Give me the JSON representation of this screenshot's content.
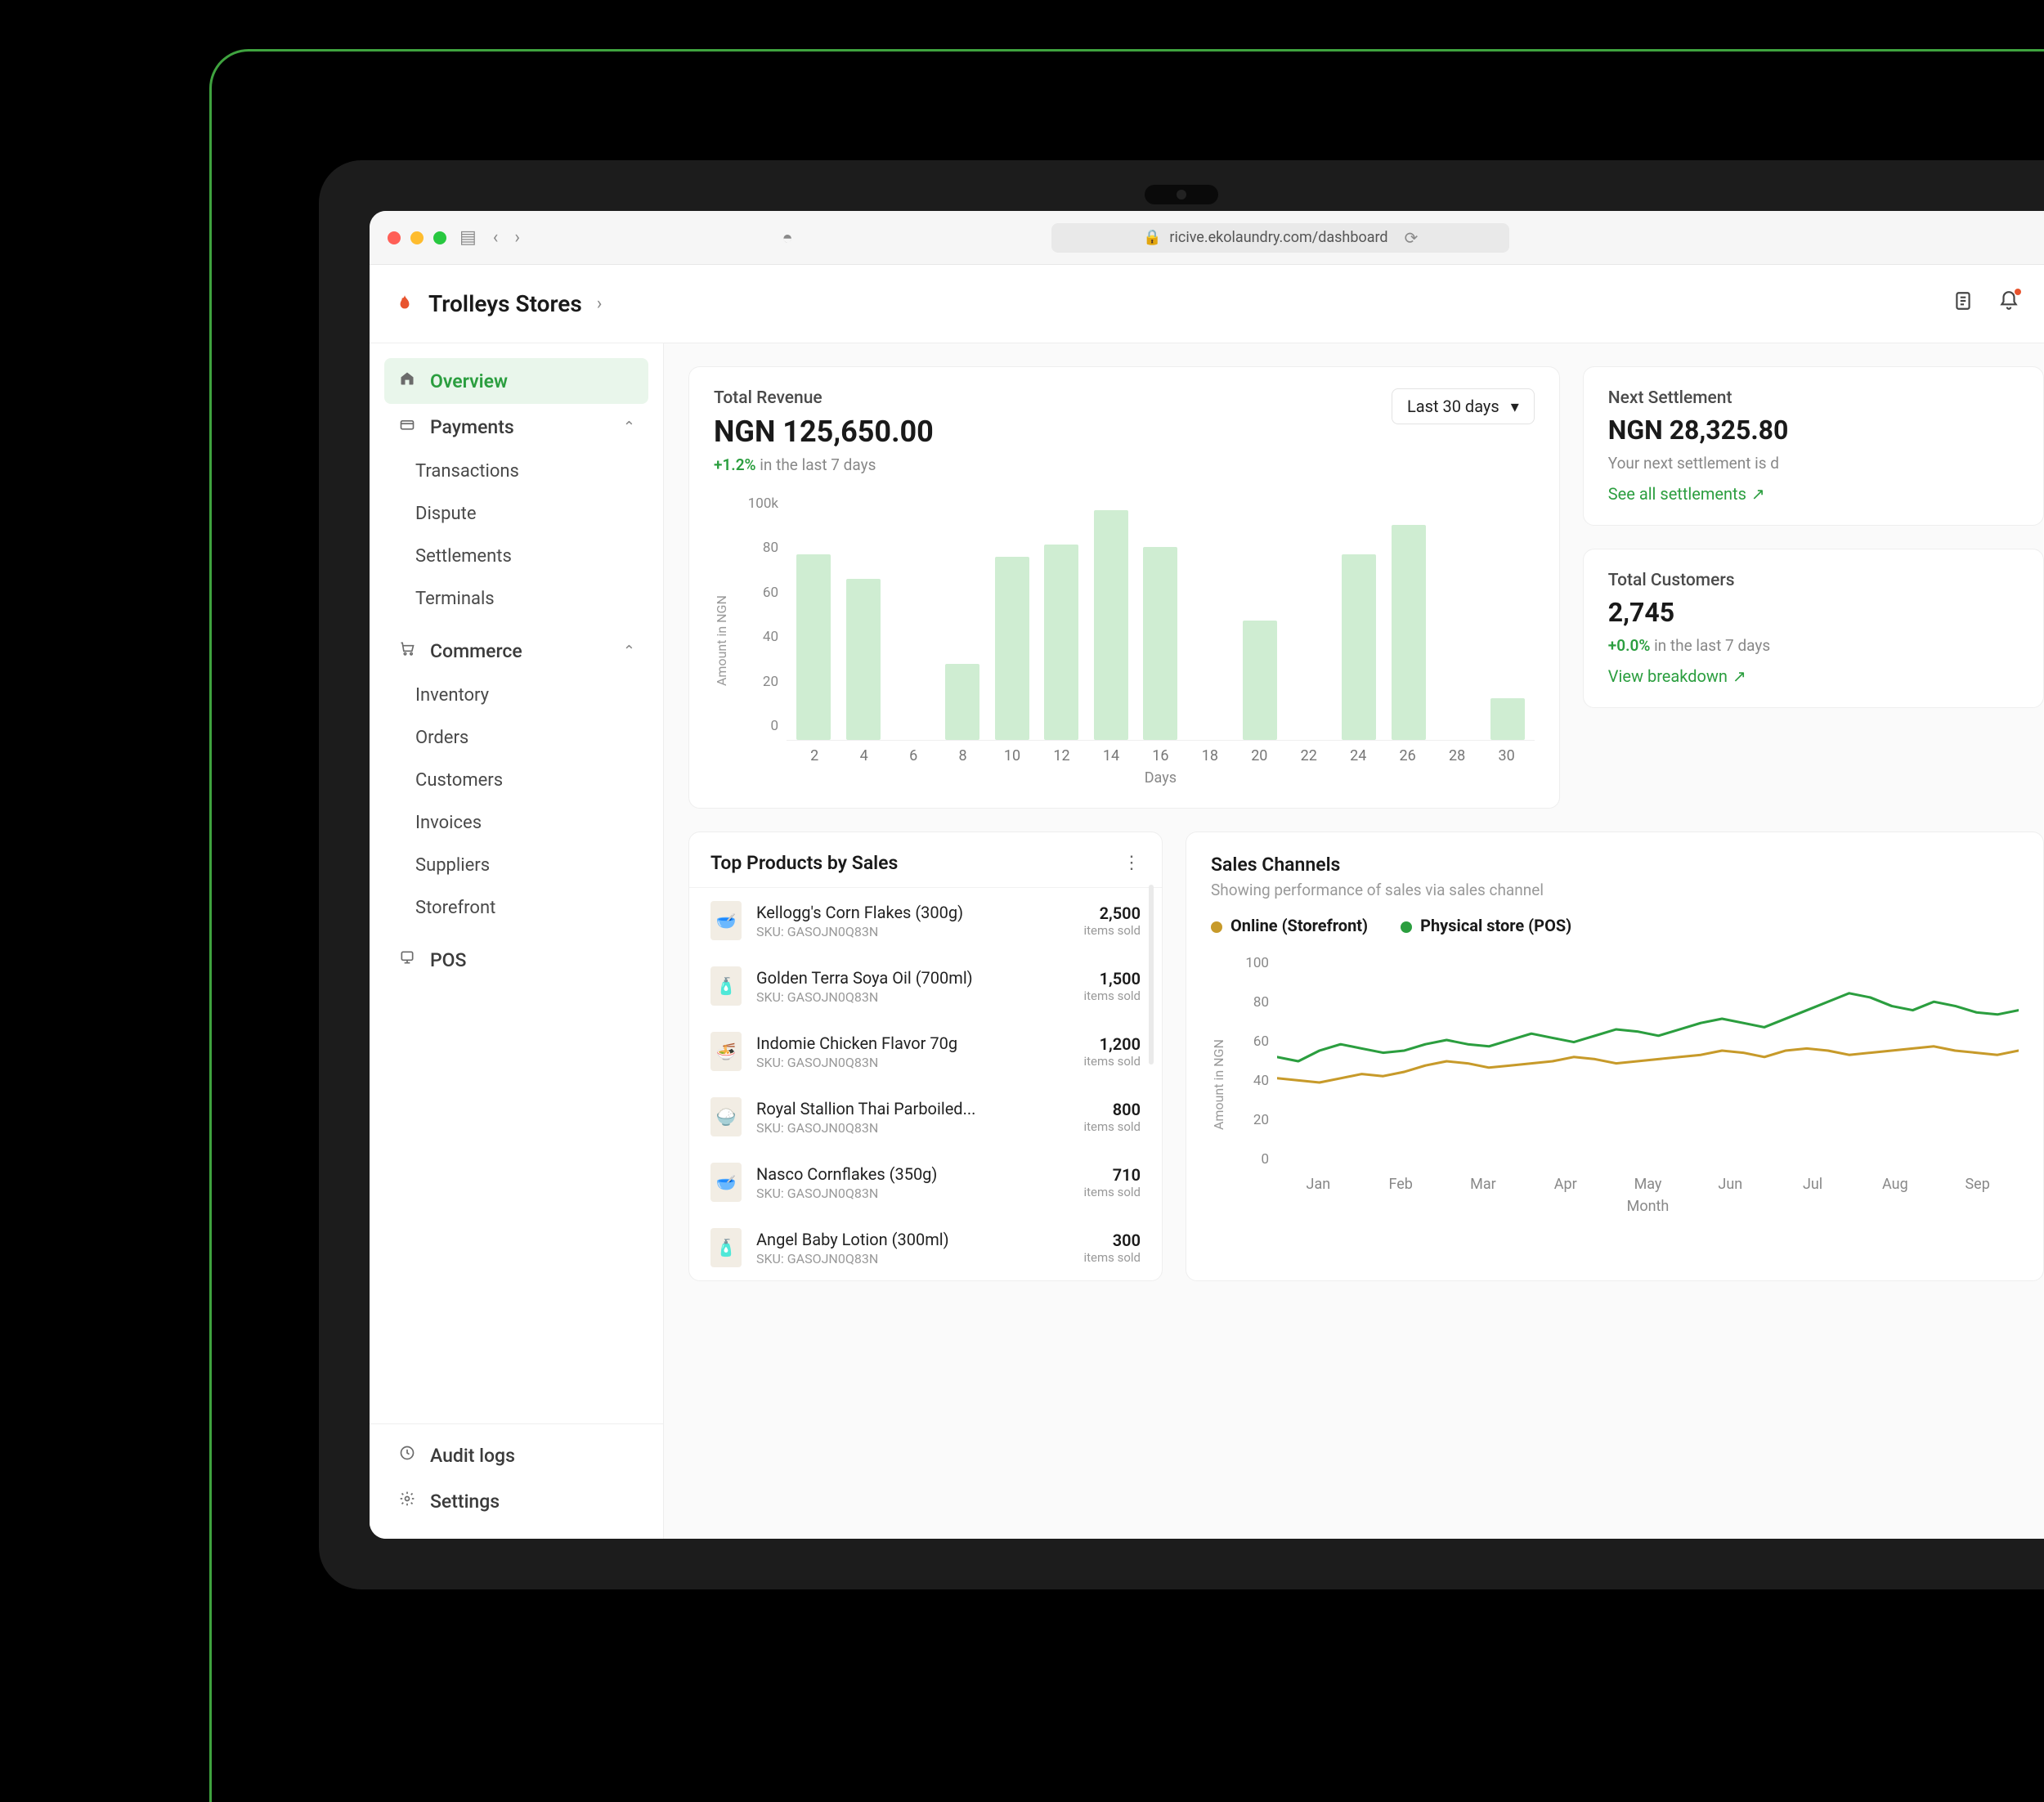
{
  "browser": {
    "url": "ricive.ekolaundry.com/dashboard"
  },
  "brand": {
    "name": "Trolleys Stores"
  },
  "sidebar": {
    "overview": "Overview",
    "payments": {
      "label": "Payments",
      "items": [
        "Transactions",
        "Dispute",
        "Settlements",
        "Terminals"
      ]
    },
    "commerce": {
      "label": "Commerce",
      "items": [
        "Inventory",
        "Orders",
        "Customers",
        "Invoices",
        "Suppliers",
        "Storefront"
      ]
    },
    "pos": "POS",
    "audit": "Audit logs",
    "settings": "Settings"
  },
  "revenue": {
    "title": "Total Revenue",
    "amount": "NGN 125,650.00",
    "delta_pct": "+1.2%",
    "delta_rest": "in the last 7 days",
    "period": "Last 30 days",
    "yLabel": "Amount in NGN",
    "xLabel": "Days"
  },
  "settlement": {
    "title": "Next Settlement",
    "amount": "NGN 28,325.80",
    "desc": "Your next settlement is d",
    "link": "See all settlements"
  },
  "customers": {
    "title": "Total Customers",
    "amount": "2,745",
    "delta_pct": "+0.0%",
    "delta_rest": "in the last 7 days",
    "link": "View breakdown"
  },
  "topProducts": {
    "title": "Top Products by Sales",
    "itemsSoldLabel": "items sold",
    "skuPrefix": "SKU:",
    "items": [
      {
        "name": "Kellogg's Corn Flakes (300g)",
        "sku": "GASOJN0Q83N",
        "qty": "2,500",
        "emoji": "🥣"
      },
      {
        "name": "Golden Terra Soya Oil (700ml)",
        "sku": "GASOJN0Q83N",
        "qty": "1,500",
        "emoji": "🧴"
      },
      {
        "name": "Indomie Chicken Flavor 70g",
        "sku": "GASOJN0Q83N",
        "qty": "1,200",
        "emoji": "🍜"
      },
      {
        "name": "Royal Stallion Thai Parboiled...",
        "sku": "GASOJN0Q83N",
        "qty": "800",
        "emoji": "🍚"
      },
      {
        "name": "Nasco Cornflakes (350g)",
        "sku": "GASOJN0Q83N",
        "qty": "710",
        "emoji": "🥣"
      },
      {
        "name": "Angel Baby Lotion (300ml)",
        "sku": "GASOJN0Q83N",
        "qty": "300",
        "emoji": "🧴"
      }
    ]
  },
  "channels": {
    "title": "Sales Channels",
    "subtitle": "Showing performance of sales via sales channel",
    "legend": {
      "online": "Online (Storefront)",
      "pos": "Physical store (POS)"
    },
    "yLabel": "Amount in NGN",
    "xLabel": "Month"
  },
  "chart_data": [
    {
      "type": "bar",
      "title": "Total Revenue",
      "xlabel": "Days",
      "ylabel": "Amount in NGN",
      "ylim": [
        0,
        100
      ],
      "yticks": [
        0,
        20,
        40,
        60,
        80,
        100
      ],
      "ytick_suffix": "k",
      "categories": [
        2,
        4,
        6,
        8,
        10,
        12,
        14,
        16,
        18,
        20,
        22,
        24,
        26,
        28,
        30
      ],
      "values": [
        76,
        66,
        0,
        31,
        75,
        80,
        94,
        79,
        0,
        49,
        0,
        76,
        88,
        0,
        17
      ]
    },
    {
      "type": "line",
      "title": "Sales Channels",
      "xlabel": "Month",
      "ylabel": "Amount in NGN",
      "ylim": [
        0,
        100
      ],
      "yticks": [
        0,
        20,
        40,
        60,
        80,
        100
      ],
      "categories": [
        "Jan",
        "Feb",
        "Mar",
        "Apr",
        "May",
        "Jun",
        "Jul",
        "Aug",
        "Sep"
      ],
      "series": [
        {
          "name": "Online (Storefront)",
          "color": "#c79a2a",
          "values": [
            42,
            41,
            40,
            42,
            44,
            43,
            45,
            48,
            50,
            49,
            47,
            48,
            49,
            50,
            52,
            51,
            49,
            50,
            51,
            52,
            53,
            55,
            54,
            52,
            55,
            56,
            55,
            53,
            54,
            55,
            56,
            57,
            55,
            54,
            53,
            55
          ]
        },
        {
          "name": "Physical store (POS)",
          "color": "#2b9e3f",
          "values": [
            52,
            50,
            55,
            58,
            56,
            54,
            55,
            58,
            60,
            58,
            57,
            60,
            63,
            61,
            59,
            62,
            65,
            64,
            62,
            65,
            68,
            70,
            68,
            66,
            70,
            74,
            78,
            82,
            80,
            76,
            74,
            78,
            76,
            73,
            72,
            74
          ]
        }
      ]
    }
  ]
}
